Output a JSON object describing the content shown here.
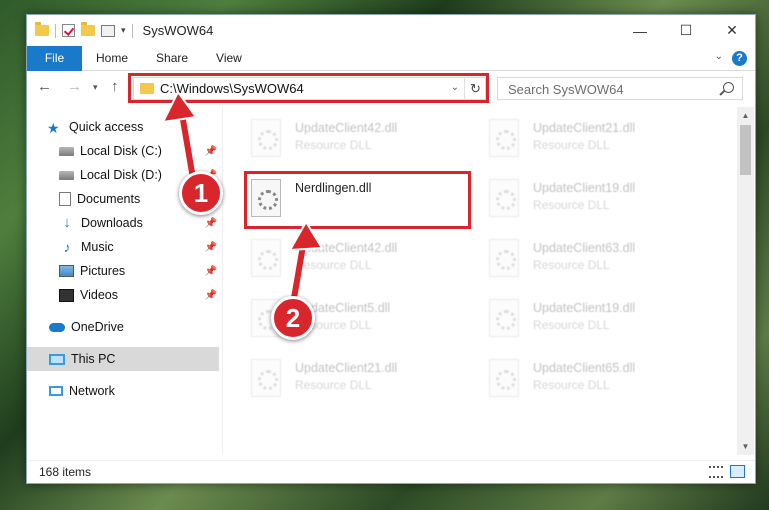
{
  "window": {
    "title": "SysWOW64"
  },
  "controls": {
    "minimize": "—",
    "maximize": "☐",
    "close": "✕"
  },
  "ribbon": {
    "tabs": [
      "File",
      "Home",
      "Share",
      "View"
    ],
    "help": "?"
  },
  "address": {
    "path": "C:\\Windows\\SysWOW64",
    "refresh": "↻"
  },
  "search": {
    "placeholder": "Search SysWOW64"
  },
  "nav": {
    "items": [
      {
        "label": "Quick access"
      },
      {
        "label": "Local Disk (C:)"
      },
      {
        "label": "Local Disk (D:)"
      },
      {
        "label": "Documents"
      },
      {
        "label": "Downloads"
      },
      {
        "label": "Music"
      },
      {
        "label": "Pictures"
      },
      {
        "label": "Videos"
      },
      {
        "label": "OneDrive"
      },
      {
        "label": "This PC"
      },
      {
        "label": "Network"
      }
    ]
  },
  "files": [
    {
      "name": "UpdateClient42.dll",
      "type": "Resource DLL"
    },
    {
      "name": "UpdateClient21.dll",
      "type": "Resource DLL"
    },
    {
      "name": "Nerdlingen.dll",
      "type": ""
    },
    {
      "name": "UpdateClient19.dll",
      "type": "Resource DLL"
    },
    {
      "name": "UpdateClient42.dll",
      "type": "Resource DLL"
    },
    {
      "name": "UpdateClient63.dll",
      "type": "Resource DLL"
    },
    {
      "name": "UpdateClient5.dll",
      "type": "Resource DLL"
    },
    {
      "name": "UpdateClient19.dll",
      "type": "Resource DLL"
    },
    {
      "name": "UpdateClient21.dll",
      "type": "Resource DLL"
    },
    {
      "name": "UpdateClient65.dll",
      "type": "Resource DLL"
    }
  ],
  "status": {
    "count": "168 items"
  },
  "annotations": {
    "step1": "1",
    "step2": "2"
  },
  "colors": {
    "accent": "#1979ca",
    "highlight": "#d9262c"
  }
}
